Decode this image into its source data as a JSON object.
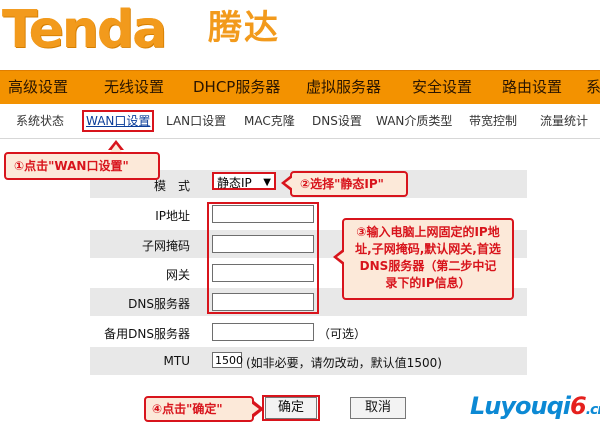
{
  "header": {
    "logo": "Tenda",
    "logo_cn": "腾达"
  },
  "main_nav": {
    "items": [
      "高级设置",
      "无线设置",
      "DHCP服务器",
      "虚拟服务器",
      "安全设置",
      "路由设置",
      "系"
    ]
  },
  "sub_nav": {
    "items": [
      "系统状态",
      "WAN口设置",
      "LAN口设置",
      "MAC克隆",
      "DNS设置",
      "WAN介质类型",
      "带宽控制",
      "流量统计"
    ],
    "active": "WAN口设置"
  },
  "form": {
    "mode_label": "模　式",
    "mode_value": "静态IP",
    "ip_label": "IP地址",
    "subnet_label": "子网掩码",
    "gateway_label": "网关",
    "dns_label": "DNS服务器",
    "alt_dns_label": "备用DNS服务器",
    "alt_dns_hint": "（可选）",
    "mtu_label": "MTU",
    "mtu_value": "1500",
    "mtu_hint": "(如非必要，请勿改动，默认值1500)",
    "ok_button": "确定",
    "cancel_button": "取消"
  },
  "callouts": {
    "step1": "①点击\"WAN口设置\"",
    "step2": "②选择\"静态IP\"",
    "step3_lines": [
      "③输入电脑上网固定的IP地",
      "址,子网掩码,默认网关,首选",
      "DNS服务器（第二步中记",
      "录下的IP信息）"
    ],
    "step4": "④点击\"确定\""
  },
  "watermark": {
    "part1": "Luyouqi",
    "part2": "6",
    "part3": ".cn"
  },
  "colors": {
    "brand_orange": "#f39200",
    "highlight_red": "#d8141c",
    "callout_bg": "#fce9d9"
  }
}
